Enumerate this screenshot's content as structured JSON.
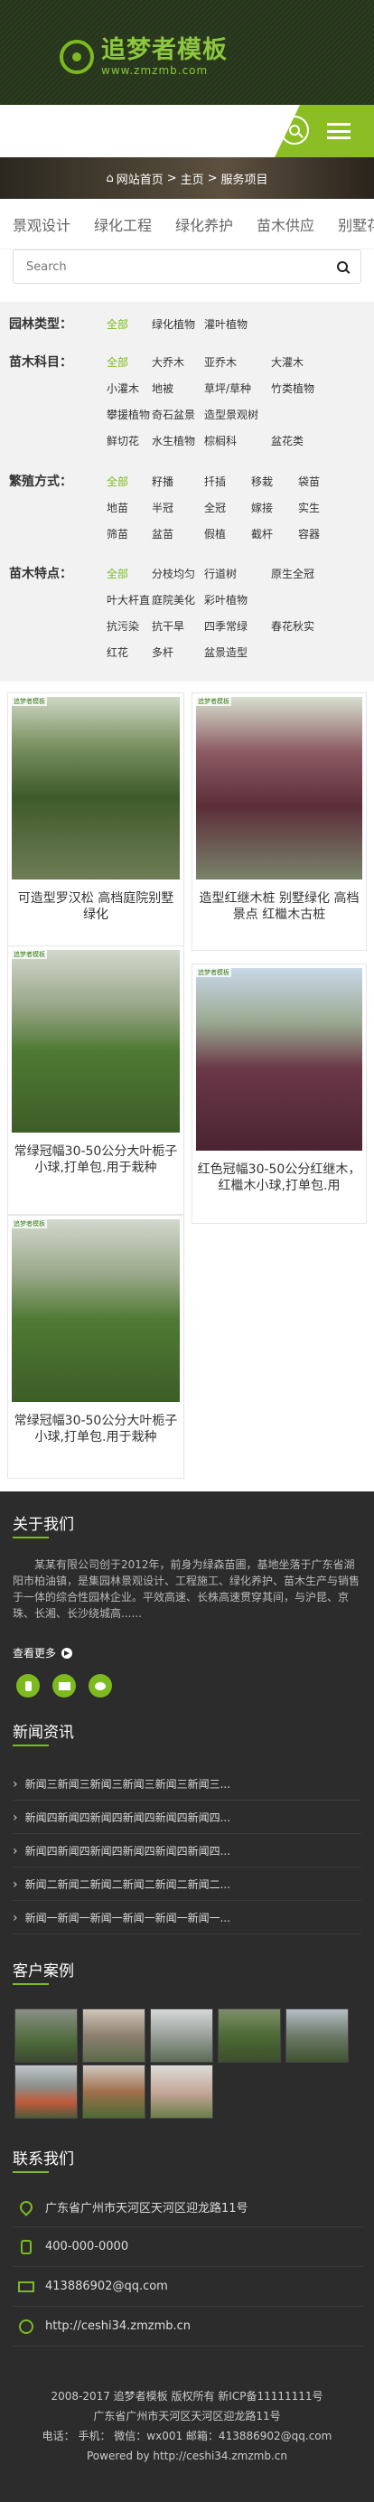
{
  "header": {
    "logo_name": "追梦者模板",
    "logo_url": "www.zmzmb.com",
    "accent": "#8dc63f"
  },
  "breadcrumb": {
    "home": "网站首页",
    "sep": ">",
    "level1": "主页",
    "level2": "服务项目"
  },
  "tabs": [
    "景观设计",
    "绿化工程",
    "绿化养护",
    "苗木供应",
    "别墅花园"
  ],
  "search": {
    "placeholder": "Search"
  },
  "filters": [
    {
      "label": "园林类型：",
      "options": [
        "全部",
        "绿化植物",
        "灌叶植物"
      ]
    },
    {
      "label": "苗木科目：",
      "options": [
        "全部",
        "大乔木",
        "亚乔木",
        "大灌木",
        "小灌木",
        "地被",
        "草坪/草种",
        "竹类植物",
        "攀援植物",
        "奇石盆景",
        "造型景观树",
        "鲜切花",
        "水生植物",
        "棕榈科",
        "盆花类"
      ]
    },
    {
      "label": "繁殖方式：",
      "options": [
        "全部",
        "籽播",
        "扦插",
        "移栽",
        "袋苗",
        "地苗",
        "半冠",
        "全冠",
        "嫁接",
        "实生",
        "筛苗",
        "盆苗",
        "假植",
        "截杆",
        "容器"
      ]
    },
    {
      "label": "苗木特点：",
      "options": [
        "全部",
        "分枝均匀",
        "行道树",
        "原生全冠",
        "叶大杆直",
        "庭院美化",
        "彩叶植物",
        "抗污染",
        "抗干旱",
        "四季常绿",
        "春花秋实",
        "红花",
        "多杆",
        "盆景造型"
      ]
    }
  ],
  "products": [
    {
      "caption": "可造型罗汉松 高档庭院别墅绿化"
    },
    {
      "caption": "造型红继木桩 别墅绿化 高档景点 红檵木古桩"
    },
    {
      "caption": "常绿冠幅30-50公分大叶栀子小球,打单包.用于栽种"
    },
    {
      "caption": "红色冠幅30-50公分红继木，红檵木小球,打单包.用"
    },
    {
      "caption": "常绿冠幅30-50公分大叶栀子小球,打单包.用于栽种"
    }
  ],
  "product_tag": "追梦者模板",
  "about": {
    "title": "关于我们",
    "text": "某某有限公司创于2012年，前身为绿森苗圃，基地坐落于广东省湖阳市柏油镇，是集园林景观设计、工程施工、绿化养护、苗木生产与销售于一体的综合性园林企业。平效高速、长株高速贯穿其间，与沪昆、京珠、长湘、长沙绕城高......",
    "more": "查看更多"
  },
  "news": {
    "title": "新闻资讯",
    "items": [
      "新闻三新闻三新闻三新闻三新闻三新闻三...",
      "新闻四新闻四新闻四新闻四新闻四新闻四...",
      "新闻四新闻四新闻四新闻四新闻四新闻四...",
      "新闻二新闻二新闻二新闻二新闻二新闻二...",
      "新闻一新闻一新闻一新闻一新闻一新闻一..."
    ]
  },
  "cases": {
    "title": "客户案例"
  },
  "contact": {
    "title": "联系我们",
    "address": "广东省广州市天河区天河区迎龙路11号",
    "tel": "400-000-0000",
    "email": "413886902@qq.com",
    "web": "http://ceshi34.zmzmb.cn"
  },
  "footer": [
    "2008-2017 追梦者模板 版权所有 新ICP备11111111号",
    "广东省广州市天河区天河区迎龙路11号",
    "电话： 手机： 微信：wx001 邮箱：413886902@qq.com",
    "Powered by http://ceshi34.zmzmb.cn"
  ]
}
